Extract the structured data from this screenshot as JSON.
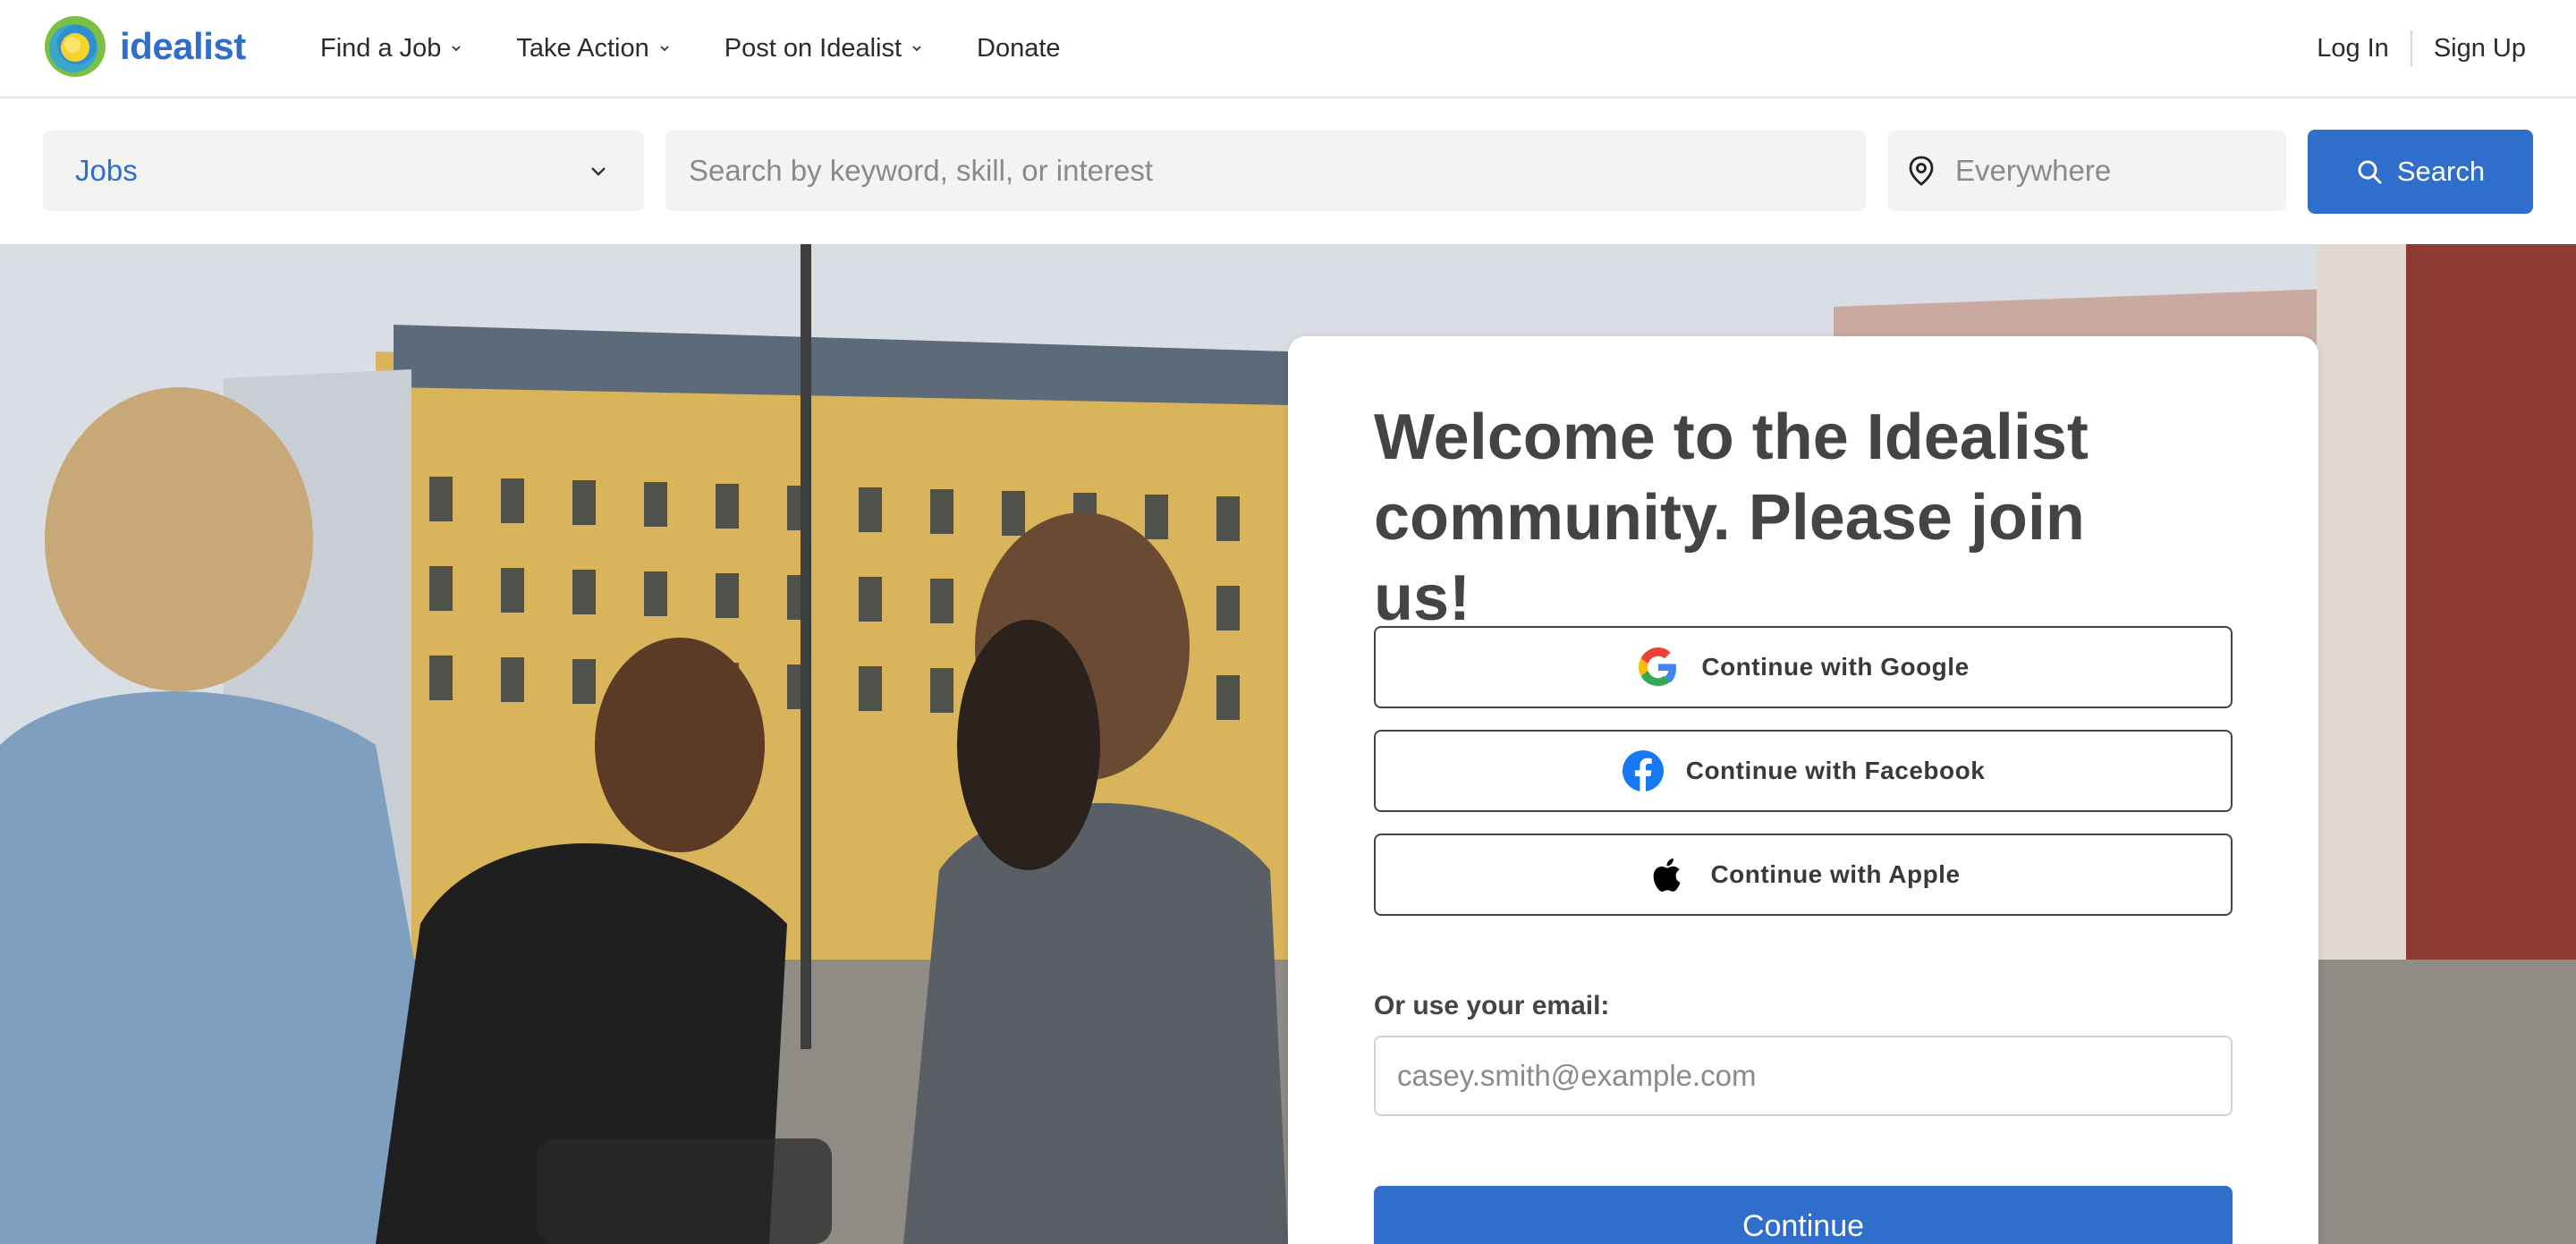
{
  "brand": {
    "name": "idealist",
    "accent": "#2f6fcb"
  },
  "nav": {
    "items": [
      {
        "label": "Find a Job",
        "has_menu": true
      },
      {
        "label": "Take Action",
        "has_menu": true
      },
      {
        "label": "Post on Idealist",
        "has_menu": true
      },
      {
        "label": "Donate",
        "has_menu": false
      }
    ],
    "login": "Log In",
    "signup": "Sign Up"
  },
  "search": {
    "type_selected": "Jobs",
    "keyword_placeholder": "Search by keyword, skill, or interest",
    "location_placeholder": "Everywhere",
    "button_label": "Search",
    "icons": {
      "chevron": "chevron-down-icon",
      "location": "map-pin-icon",
      "search": "search-icon"
    }
  },
  "hero": {
    "image": "photo of friends high-fiving on a city street"
  },
  "join_card": {
    "title": "Welcome to the Idealist community. Please join us!",
    "google_label": "Continue with Google",
    "facebook_label": "Continue with Facebook",
    "apple_label": "Continue with Apple",
    "email_label": "Or use your email:",
    "email_placeholder": "casey.smith@example.com",
    "continue_label": "Continue"
  }
}
